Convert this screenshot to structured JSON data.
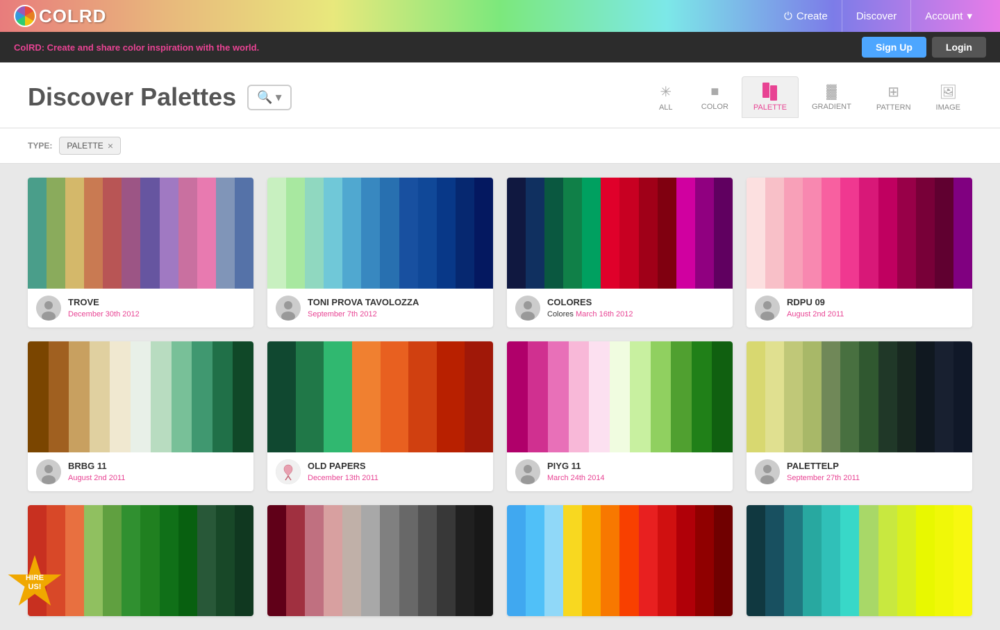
{
  "header": {
    "logo": "COLRD",
    "nav": [
      {
        "id": "create",
        "label": "Create",
        "icon": "⏻"
      },
      {
        "id": "discover",
        "label": "Discover"
      },
      {
        "id": "account",
        "label": "Account",
        "icon": "▾"
      }
    ]
  },
  "banner": {
    "text_brand": "ColRD:",
    "text_body": " Create and share color inspiration with the world.",
    "signup_label": "Sign Up",
    "login_label": "Login"
  },
  "page": {
    "title": "Discover Palettes",
    "search_placeholder": "Search..."
  },
  "filter_tabs": [
    {
      "id": "all",
      "label": "ALL",
      "icon": "✳",
      "active": false
    },
    {
      "id": "color",
      "label": "COLOR",
      "icon": "■",
      "active": false
    },
    {
      "id": "palette",
      "label": "PALETTE",
      "icon": "▐▌",
      "active": true
    },
    {
      "id": "gradient",
      "label": "GRADIENT",
      "icon": "▓",
      "active": false
    },
    {
      "id": "pattern",
      "label": "PATTERN",
      "icon": "⊞",
      "active": false
    },
    {
      "id": "image",
      "label": "IMAGE",
      "icon": "🖼",
      "active": false
    }
  ],
  "type_filter": {
    "label": "TYPE:",
    "tag": "PALETTE",
    "remove_label": "×"
  },
  "palettes": [
    {
      "id": "trove",
      "name": "TROVE",
      "date": "December 30th 2012",
      "category": null,
      "colors": [
        "#4a9e8a",
        "#8aab5c",
        "#d4b86a",
        "#c97a52",
        "#b85555",
        "#9c5585",
        "#6655a0",
        "#a079c2",
        "#c970a0",
        "#e87ab0",
        "#8095b8",
        "#5572a8"
      ]
    },
    {
      "id": "toni-prova",
      "name": "TONI PROVA TAVOLOZZA",
      "date": "September 7th 2012",
      "category": null,
      "colors": [
        "#c8f0c0",
        "#a8e8a0",
        "#90d8c0",
        "#70c8d8",
        "#50a8d0",
        "#3888c0",
        "#2870b0",
        "#1850a0",
        "#104898",
        "#083888",
        "#062870",
        "#041860"
      ]
    },
    {
      "id": "colores",
      "name": "COLORES",
      "date": "March 16th 2012",
      "category": "Colores",
      "colors": [
        "#101840",
        "#103060",
        "#0a5840",
        "#108048",
        "#00a060",
        "#e0002a",
        "#c80022",
        "#a00018",
        "#800010",
        "#d000a0",
        "#900080",
        "#600060"
      ]
    },
    {
      "id": "rdpu09",
      "name": "RDPU 09",
      "date": "August 2nd 2011",
      "category": null,
      "colors": [
        "#fce0e0",
        "#f8c0c8",
        "#f8a0b8",
        "#f888b0",
        "#f860a0",
        "#f03890",
        "#d81878",
        "#c00060",
        "#980048",
        "#780038",
        "#600030",
        "#800080"
      ]
    },
    {
      "id": "brbg11",
      "name": "BRBG 11",
      "date": "August 2nd 2011",
      "category": null,
      "colors": [
        "#7a4500",
        "#a06020",
        "#c8a060",
        "#e0d0a0",
        "#f0e8d0",
        "#e8f0e8",
        "#b8dcc0",
        "#78c098",
        "#409870",
        "#207048",
        "#104828"
      ]
    },
    {
      "id": "old-papers",
      "name": "OLD PAPERS",
      "date": "December 13th 2011",
      "category": null,
      "colors": [
        "#104830",
        "#207848",
        "#30b870",
        "#f08030",
        "#e86020",
        "#d04010",
        "#b82000",
        "#a01808"
      ]
    },
    {
      "id": "piyg11",
      "name": "PIYG 11",
      "date": "March 24th 2014",
      "category": null,
      "colors": [
        "#b0006a",
        "#d03090",
        "#e870b8",
        "#f8b8d8",
        "#fce0f0",
        "#f0fce0",
        "#c8f0a0",
        "#90d060",
        "#50a030",
        "#208018",
        "#106010"
      ]
    },
    {
      "id": "palettelp",
      "name": "PALETTELP",
      "date": "September 27th 2011",
      "category": null,
      "colors": [
        "#d8d870",
        "#e0e090",
        "#c0c878",
        "#a8b868",
        "#708858",
        "#487040",
        "#305830",
        "#203828",
        "#182820",
        "#101820",
        "#182030",
        "#101828"
      ]
    },
    {
      "id": "row3-1",
      "name": "",
      "date": "",
      "category": null,
      "colors": [
        "#c83020",
        "#d84828",
        "#e87040",
        "#90c060",
        "#60a040",
        "#309030",
        "#208020",
        "#107018",
        "#086010",
        "#285838",
        "#184828",
        "#103820"
      ]
    },
    {
      "id": "row3-2",
      "name": "",
      "date": "",
      "category": null,
      "colors": [
        "#600018",
        "#a03040",
        "#c07080",
        "#d8a0a0",
        "#c0b0a8",
        "#a8a8a8",
        "#808080",
        "#686868",
        "#505050",
        "#383838",
        "#202020",
        "#181818"
      ]
    },
    {
      "id": "row3-3",
      "name": "",
      "date": "",
      "category": null,
      "colors": [
        "#40a8f0",
        "#50c0f8",
        "#90d8f8",
        "#f8d820",
        "#f8a800",
        "#f87800",
        "#f84000",
        "#e82020",
        "#d01010",
        "#b00008",
        "#900000",
        "#700000"
      ]
    },
    {
      "id": "row3-4",
      "name": "",
      "date": "",
      "category": null,
      "colors": [
        "#103840",
        "#185060",
        "#207880",
        "#28a8a0",
        "#30c0b8",
        "#38d8c8",
        "#a8d868",
        "#c8e840",
        "#d8f020",
        "#e8f800",
        "#f0f808",
        "#f8f810"
      ]
    }
  ],
  "hire_badge": {
    "line1": "HIRE",
    "line2": "US!"
  }
}
